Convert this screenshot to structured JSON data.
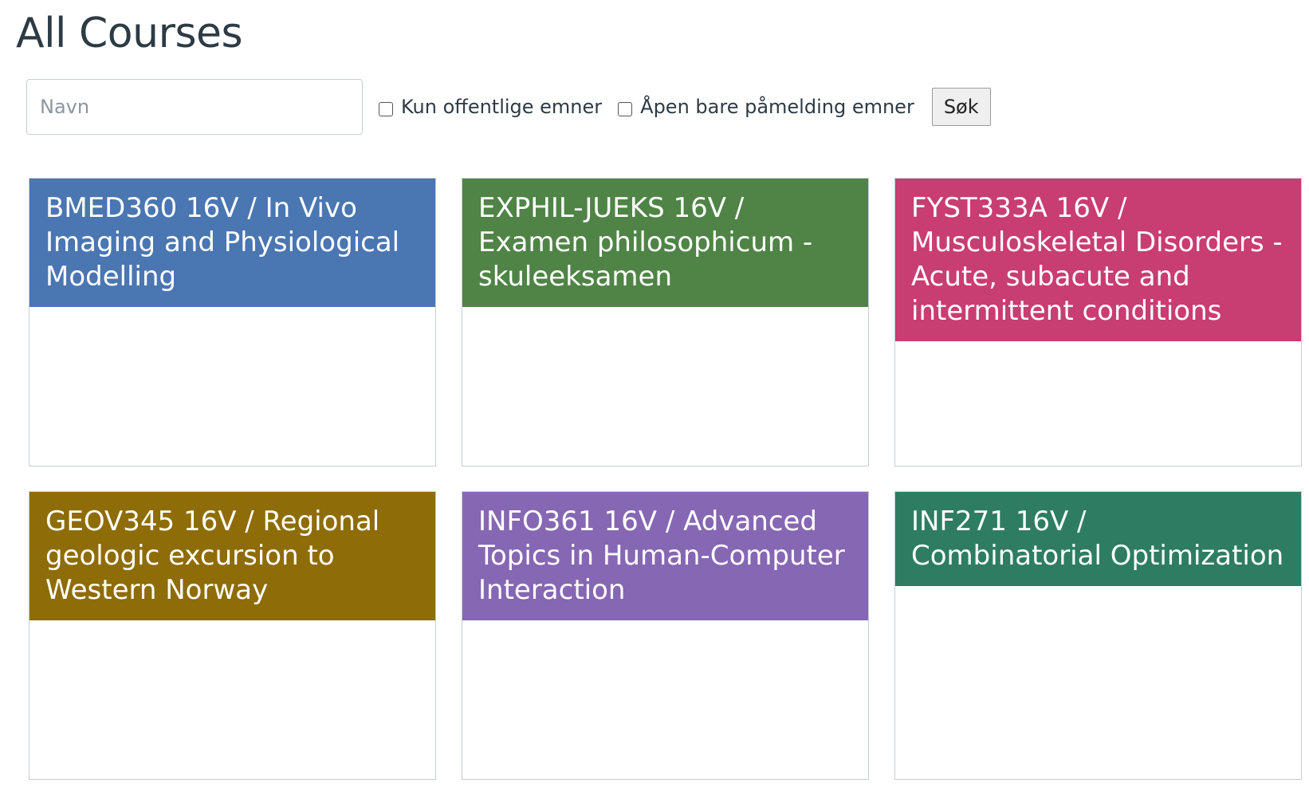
{
  "page_title": "All Courses",
  "search": {
    "placeholder": "Navn",
    "value": "",
    "public_only_label": "Kun offentlige emner",
    "open_enrollment_label": "Åpen bare påmelding emner",
    "submit_label": "Søk"
  },
  "courses": [
    {
      "title": "BMED360 16V / In Vivo Imaging and Physiological Modelling",
      "color": "#4a76b2"
    },
    {
      "title": "EXPHIL-JUEKS 16V / Examen philosophicum - skuleeksamen",
      "color": "#4f8446"
    },
    {
      "title": "FYST333A 16V / Musculoskeletal Disorders - Acute, subacute and intermittent conditions",
      "color": "#c83d72"
    },
    {
      "title": "GEOV345 16V / Regional geologic excursion to Western Norway",
      "color": "#8e6c07"
    },
    {
      "title": "INFO361 16V / Advanced Topics in Human-Computer Interaction",
      "color": "#8667b3"
    },
    {
      "title": "INF271 16V / Combinatorial Optimization",
      "color": "#2e7d63"
    }
  ]
}
